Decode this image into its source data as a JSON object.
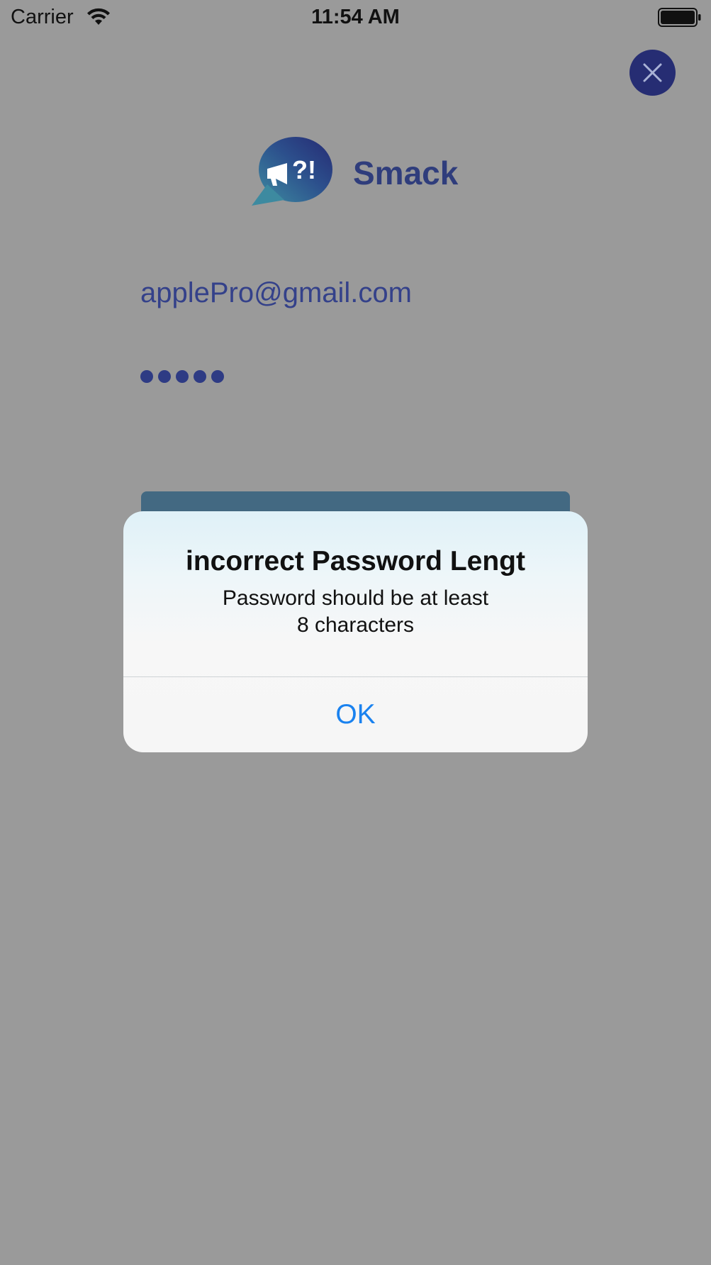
{
  "status_bar": {
    "carrier": "Carrier",
    "time": "11:54 AM",
    "wifi_icon": "wifi-icon",
    "battery_icon": "battery-icon"
  },
  "header": {
    "close_icon": "close-icon",
    "close_color": "#262d73"
  },
  "logo": {
    "title": "Smack",
    "icon": "speech-bubble-megaphone-icon",
    "title_color": "#2f3d7c"
  },
  "form": {
    "email_value": "applePro@gmail.com",
    "password_length": 5,
    "login_button_color": "#436982"
  },
  "alert": {
    "title": "incorrect Password Lengt",
    "message_line1": "Password should be at least",
    "message_line2": "8 characters",
    "ok_label": "OK",
    "ok_color": "#1a82ef"
  },
  "colors": {
    "overlay_background": "#9a9a9a",
    "accent_navy": "#262d73"
  }
}
